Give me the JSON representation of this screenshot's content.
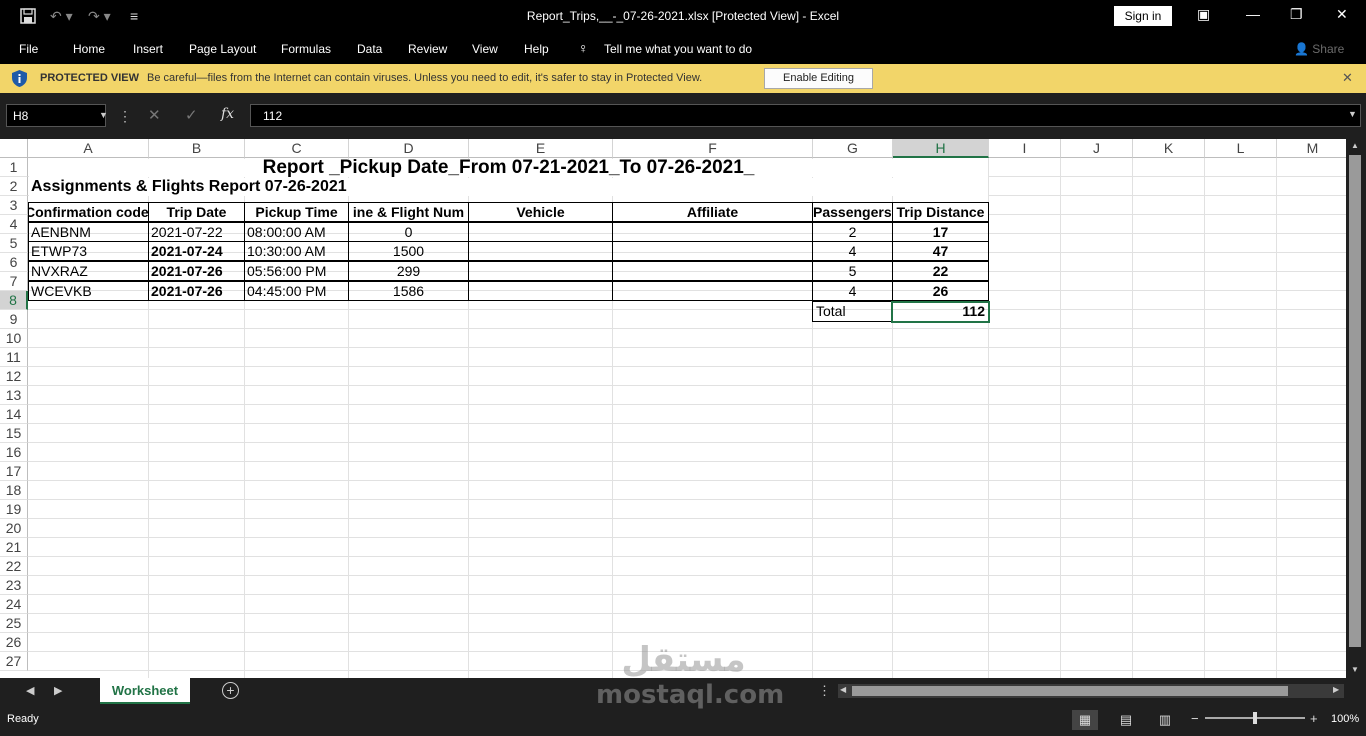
{
  "window": {
    "title": "Report_Trips,__-_07-26-2021.xlsx  [Protected View]  -  Excel",
    "sign_in": "Sign in"
  },
  "menu": {
    "items": [
      "File",
      "Home",
      "Insert",
      "Page Layout",
      "Formulas",
      "Data",
      "Review",
      "View",
      "Help"
    ],
    "tell_me": "Tell me what you want to do",
    "share": "Share"
  },
  "protected_view": {
    "label": "PROTECTED VIEW",
    "message": "Be careful—files from the Internet can contain viruses. Unless you need to edit, it's safer to stay in Protected View.",
    "enable_button": "Enable Editing"
  },
  "formula_bar": {
    "name_box": "H8",
    "fx": "fx",
    "value": "112"
  },
  "columns": [
    "A",
    "B",
    "C",
    "D",
    "E",
    "F",
    "G",
    "H",
    "I",
    "J",
    "K",
    "L",
    "M"
  ],
  "selected_column": "H",
  "rows": [
    "1",
    "2",
    "3",
    "4",
    "5",
    "6",
    "7",
    "8",
    "9",
    "10",
    "11",
    "12",
    "13",
    "14",
    "15",
    "16",
    "17",
    "18",
    "19",
    "20",
    "21",
    "22",
    "23",
    "24",
    "25",
    "26",
    "27"
  ],
  "selected_row": "8",
  "sheet": {
    "title": "Report _Pickup Date_From 07-21-2021_To 07-26-2021_",
    "subtitle": "Assignments & Flights Report 07-26-2021",
    "headers": [
      "Confirmation code",
      "Trip Date",
      "Pickup Time",
      "Airline & Flight Number",
      "Vehicle",
      "Affiliate",
      "Passengers",
      "Trip Distance"
    ],
    "header_visible": [
      "Confirmation code",
      "Trip Date",
      "Pickup Time",
      "ine & Flight Num",
      "Vehicle",
      "Affiliate",
      "Passengers",
      "Trip Distance"
    ],
    "records": [
      {
        "code": "AENBNM",
        "date": "2021-07-22",
        "time": "08:00:00 AM",
        "flight": "0",
        "vehicle": "",
        "affiliate": "",
        "passengers": "2",
        "distance": "17"
      },
      {
        "code": "ETWP73",
        "date": "2021-07-24",
        "time": "10:30:00 AM",
        "flight": "1500",
        "vehicle": "",
        "affiliate": "",
        "passengers": "4",
        "distance": "47"
      },
      {
        "code": "NVXRAZ",
        "date": "2021-07-26",
        "time": "05:56:00 PM",
        "flight": "299",
        "vehicle": "",
        "affiliate": "",
        "passengers": "5",
        "distance": "22"
      },
      {
        "code": "WCEVKB",
        "date": "2021-07-26",
        "time": "04:45:00 PM",
        "flight": "1586",
        "vehicle": "",
        "affiliate": "",
        "passengers": "4",
        "distance": "26"
      }
    ],
    "total_label": "Total",
    "total_value": "112"
  },
  "sheet_tabs": [
    "Worksheet"
  ],
  "status": {
    "ready": "Ready",
    "zoom": "100%"
  },
  "watermark": {
    "arabic": "مستقل",
    "latin": "mostaql.com"
  }
}
